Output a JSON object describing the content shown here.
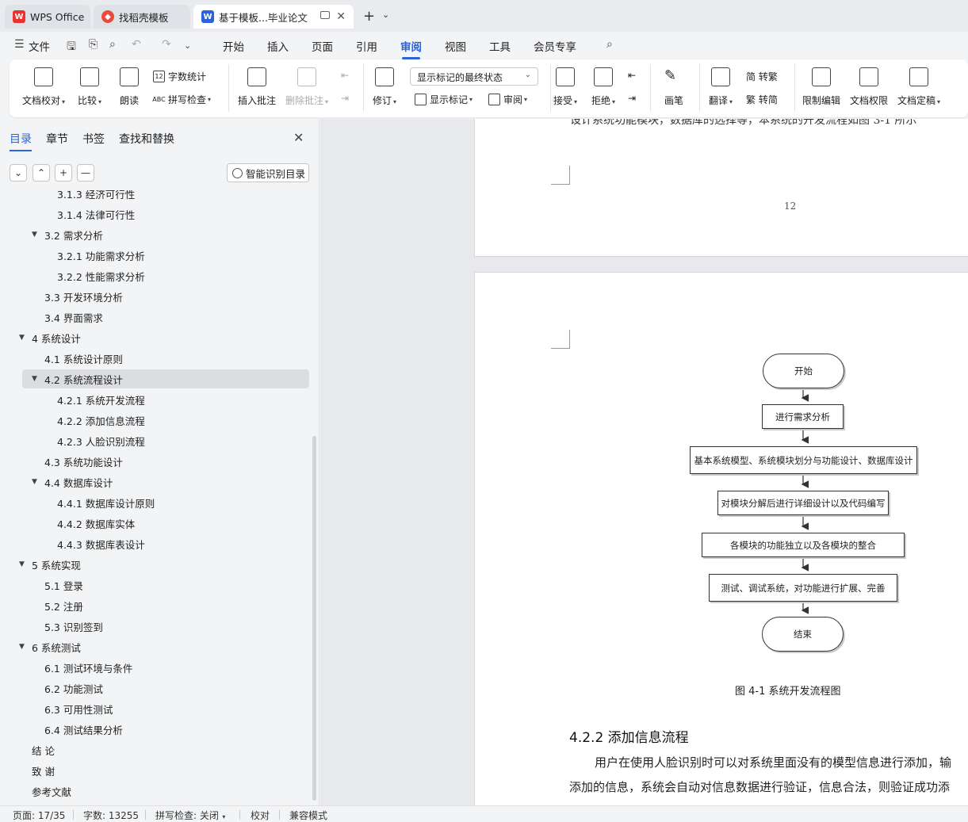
{
  "tabs": [
    {
      "label": "WPS Office",
      "icon": "wps-logo-icon"
    },
    {
      "label": "找稻壳模板",
      "icon": "docer-icon"
    },
    {
      "label": "基于模板...毕业论文",
      "icon": "word-doc-icon"
    }
  ],
  "menu": {
    "file": "文件",
    "items": [
      "开始",
      "插入",
      "页面",
      "引用",
      "审阅",
      "视图",
      "工具",
      "会员专享"
    ],
    "active": "审阅"
  },
  "ribbon": {
    "doc_check": "文档校对",
    "compare": "比较",
    "read_aloud": "朗读",
    "word_count": "字数统计",
    "spell_check": "拼写检查",
    "insert_comment": "插入批注",
    "delete_comment": "删除批注",
    "revise": "修订",
    "markup_state": "显示标记的最终状态",
    "show_markup": "显示标记",
    "review_pane": "审阅",
    "accept": "接受",
    "reject": "拒绝",
    "ink": "画笔",
    "translate": "翻译",
    "to_traditional": "简 转繁",
    "to_simplified": "繁 转简",
    "restrict_edit": "限制编辑",
    "doc_permission": "文档权限",
    "doc_finalize": "文档定稿"
  },
  "sidebar": {
    "tabs": [
      "目录",
      "章节",
      "书签",
      "查找和替换"
    ],
    "smart_toc": "智能识别目录",
    "toc": [
      {
        "text": "3.1.3  经济可行性",
        "level": 3
      },
      {
        "text": "3.1.4  法律可行性",
        "level": 3
      },
      {
        "text": "3.2 需求分析",
        "level": 2,
        "arrow": "▼"
      },
      {
        "text": "3.2.1  功能需求分析",
        "level": 3
      },
      {
        "text": "3.2.2  性能需求分析",
        "level": 3
      },
      {
        "text": "3.3 开发环境分析",
        "level": 2
      },
      {
        "text": "3.4 界面需求",
        "level": 2
      },
      {
        "text": "4  系统设计",
        "level": 1,
        "arrow": "▼"
      },
      {
        "text": "4.1 系统设计原则",
        "level": 2
      },
      {
        "text": "4.2 系统流程设计",
        "level": 2,
        "arrow": "▼",
        "selected": true
      },
      {
        "text": "4.2.1 系统开发流程",
        "level": 3
      },
      {
        "text": "4.2.2  添加信息流程",
        "level": 3
      },
      {
        "text": "4.2.3  人脸识别流程",
        "level": 3
      },
      {
        "text": "4.3  系统功能设计",
        "level": 2
      },
      {
        "text": "4.4  数据库设计",
        "level": 2,
        "arrow": "▼"
      },
      {
        "text": "4.4.1  数据库设计原则",
        "level": 3
      },
      {
        "text": "4.4.2  数据库实体",
        "level": 3
      },
      {
        "text": "4.4.3  数据库表设计",
        "level": 3
      },
      {
        "text": "5 系统实现",
        "level": 1,
        "arrow": "▼"
      },
      {
        "text": "5.1  登录",
        "level": 2
      },
      {
        "text": "5.2  注册",
        "level": 2
      },
      {
        "text": "5.3  识别签到",
        "level": 2
      },
      {
        "text": "6 系统测试",
        "level": 1,
        "arrow": "▼"
      },
      {
        "text": "6.1 测试环境与条件",
        "level": 2
      },
      {
        "text": "6.2 功能测试",
        "level": 2
      },
      {
        "text": "6.3 可用性测试",
        "level": 2
      },
      {
        "text": "6.4 测试结果分析",
        "level": 2
      },
      {
        "text": "结      论",
        "level": 1
      },
      {
        "text": "致      谢",
        "level": 1
      },
      {
        "text": "参考文献",
        "level": 1
      }
    ]
  },
  "document": {
    "cut_line": "设计系统功能模块，数据库的选择等，本系统的开发流程如图 3-1 所示",
    "page_number": "12",
    "flowchart": {
      "nodes": [
        {
          "id": "start",
          "text": "开始",
          "type": "terminal"
        },
        {
          "id": "n1",
          "text": "进行需求分析",
          "type": "process"
        },
        {
          "id": "n2",
          "text": "基本系统模型、系统模块划分与功能设计、数据库设计",
          "type": "process"
        },
        {
          "id": "n3",
          "text": "对模块分解后进行详细设计以及代码编写",
          "type": "process"
        },
        {
          "id": "n4",
          "text": "各模块的功能独立以及各模块的整合",
          "type": "process"
        },
        {
          "id": "n5",
          "text": "测试、调试系统，对功能进行扩展、完善",
          "type": "process"
        },
        {
          "id": "end",
          "text": "结束",
          "type": "terminal"
        }
      ]
    },
    "caption": "图 4-1 系统开发流程图",
    "heading": "4.2.2  添加信息流程",
    "para1": "用户在使用人脸识别时可以对系统里面没有的模型信息进行添加，输",
    "para2": "添加的信息，系统会自动对信息数据进行验证，信息合法，则验证成功添"
  },
  "status": {
    "page": "页面: 17/35",
    "words": "字数: 13255",
    "spell": "拼写检查: 关闭",
    "proof": "校对",
    "compat": "兼容模式"
  }
}
